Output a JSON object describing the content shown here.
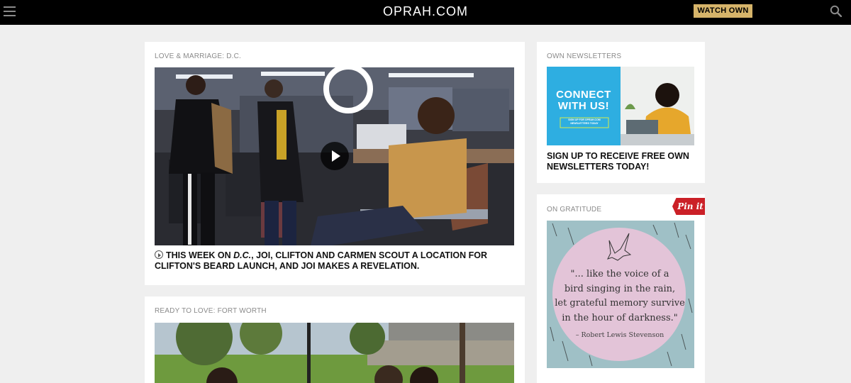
{
  "site": {
    "logo": "OPRAH.COM",
    "watch_label": "WATCH OWN"
  },
  "icons": {
    "menu": "hamburger-menu-icon",
    "search": "search-icon",
    "play": "play-icon",
    "video": "video-play-icon",
    "bird": "dove-icon"
  },
  "colors": {
    "topbar": "#000000",
    "watch_button": "#d6b46a",
    "pinterest": "#cb2027",
    "newsletter_blue": "#2eaee1",
    "quote_circle": "#e3c4d8"
  },
  "feature_one": {
    "label": "LOVE & MARRIAGE: D.C.",
    "headline_pre": "THIS WEEK ON ",
    "headline_show": "D.C.",
    "headline_post": ", JOI, CLIFTON AND CARMEN SCOUT A LOCATION FOR CLIFTON'S BEARD LAUNCH, AND JOI MAKES A REVELATION."
  },
  "feature_two": {
    "label": "READY TO LOVE: FORT WORTH"
  },
  "newsletter": {
    "label": "OWN NEWSLETTERS",
    "promo_line1": "CONNECT",
    "promo_line2": "WITH US!",
    "promo_small_line1": "SIGN UP FOR OPRAH.COM",
    "promo_small_line2": "NEWSLETTERS TODAY",
    "headline": "SIGN UP TO RECEIVE FREE OWN NEWSLETTERS TODAY!"
  },
  "gratitude": {
    "label": "ON GRATITUDE",
    "pin_label": "Pin it",
    "quote_lines": [
      "\"... like the voice of a",
      "bird singing in the rain,",
      "let grateful memory survive",
      "in the hour of darkness.\""
    ],
    "author": "– Robert Lewis Stevenson"
  }
}
